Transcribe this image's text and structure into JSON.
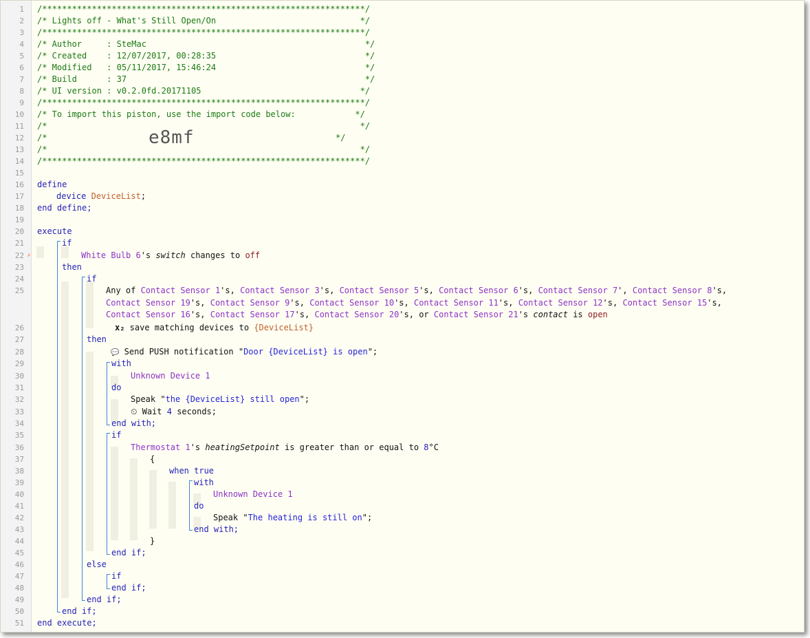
{
  "code_view": {
    "line_numbers": [
      "1",
      "2",
      "3",
      "4",
      "5",
      "6",
      "7",
      "8",
      "9",
      "10",
      "11",
      "12",
      "13",
      "14",
      "15",
      "16",
      "17",
      "18",
      "19",
      "20",
      "21",
      "22",
      "23",
      "24",
      "25",
      "26",
      "27",
      "28",
      "29",
      "30",
      "31",
      "32",
      "33",
      "34",
      "35",
      "36",
      "37",
      "38",
      "39",
      "40",
      "41",
      "42",
      "43",
      "44",
      "45",
      "46",
      "47",
      "48",
      "49",
      "50",
      "51"
    ],
    "trigger_marker": "⚡",
    "header": {
      "border": "/*****************************************************************/",
      "title": "/* Lights off - What's Still Open/On                             */",
      "author": "/* Author     : SteMac                                            */",
      "created": "/* Created    : 12/07/2017, 00:28:35                              */",
      "modified": "/* Modified   : 05/11/2017, 15:46:24                              */",
      "build": "/* Build      : 37                                                */",
      "ui_version": "/* UI version : v0.2.0fd.20171105                                */",
      "import_note": "/* To import this piston, use the import code below:            */",
      "blank": "/*                                                               */",
      "code_prefix": "/*               ",
      "import_code": "e8mf",
      "code_suffix": "                                             */"
    },
    "kw": {
      "define": "define",
      "device": "device",
      "end_define": "end define;",
      "execute": "execute",
      "if": "if",
      "then": "then",
      "else": "else",
      "with": "with",
      "do": "do",
      "end_with": "end with;",
      "end_if": "end if;",
      "when_true": "when true",
      "end_execute": "end execute;",
      "open_brace": "{",
      "close_brace": "}"
    },
    "var_decl": {
      "name": "DeviceList",
      "semi": ";"
    },
    "cond1": {
      "device": "White Bulb 6",
      "poss": "'s ",
      "attribute": "switch",
      "text": " changes to ",
      "value": "off"
    },
    "cond2": {
      "any_of": "Any of ",
      "sep": "'s, ",
      "line1_devices": [
        "Contact Sensor 1",
        "Contact Sensor 3",
        "Contact Sensor 5",
        "Contact Sensor 6"
      ],
      "sensor7": "Contact Sensor 7",
      "sensor7_sep": "', ",
      "sensor8": "Contact Sensor 8",
      "line2_devices": [
        "Contact Sensor 19",
        "Contact Sensor 9",
        "Contact Sensor 10",
        "Contact Sensor 11",
        "Contact Sensor 12",
        "Contact Sensor 15"
      ],
      "line3_devices": [
        "Contact Sensor 16",
        "Contact Sensor 17",
        "Contact Sensor 20"
      ],
      "or": "'s, or ",
      "last_device": "Contact Sensor 21",
      "poss": "'s ",
      "attribute": "contact",
      "is": " is ",
      "value": "open",
      "save_icon": "x₂",
      "save_text": " save matching devices to ",
      "save_var": "{DeviceList}"
    },
    "push": {
      "icon": "💬",
      "text": " Send PUSH notification \"",
      "message": "Door {DeviceList} is open",
      "end": "\";"
    },
    "unknown_device": "Unknown Device 1",
    "speak1": {
      "cmd": "Speak \"",
      "text": "the {DeviceList} still open",
      "end": "\";"
    },
    "wait": {
      "icon": "⏲",
      "cmd": " Wait ",
      "value": "4",
      "unit": " seconds;"
    },
    "cond3": {
      "device": "Thermostat 1",
      "poss": "'s ",
      "attribute": "heatingSetpoint",
      "text": " is greater than or equal to ",
      "value": "8",
      "unit": "°C"
    },
    "speak2": {
      "cmd": "Speak \"",
      "text": "The heating is still on",
      "end": "\";"
    }
  }
}
